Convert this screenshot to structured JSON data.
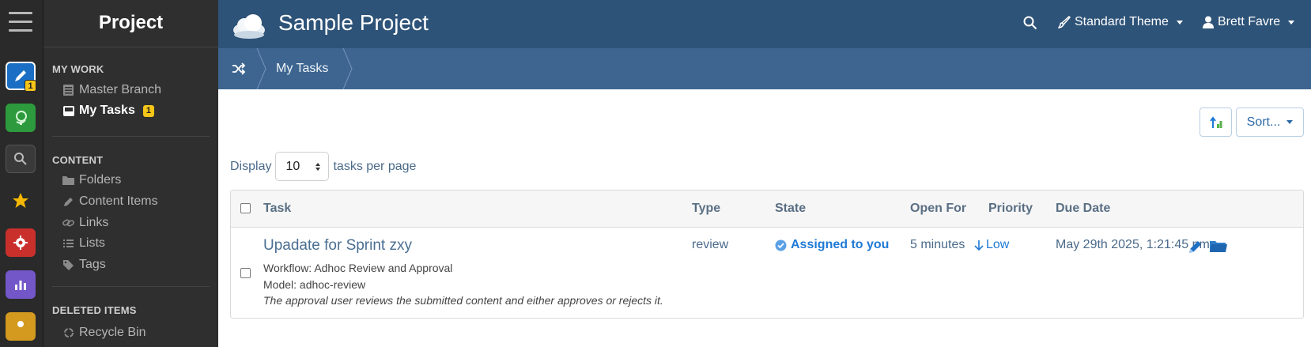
{
  "nav": {
    "title": "Project",
    "sections": {
      "my_work": "MY WORK",
      "content": "CONTENT",
      "deleted": "DELETED ITEMS"
    },
    "items": {
      "master_branch": "Master Branch",
      "my_tasks": "My Tasks",
      "my_tasks_badge": "1",
      "folders": "Folders",
      "content_items": "Content Items",
      "links": "Links",
      "lists": "Lists",
      "tags": "Tags",
      "recycle_bin": "Recycle Bin"
    }
  },
  "rail": {
    "edit_badge": "1",
    "icons": [
      "hamburger-icon",
      "pencil-icon",
      "globe-icon",
      "search-icon",
      "star-icon",
      "gear-icon",
      "chart-icon",
      "users-icon"
    ]
  },
  "header": {
    "app_title": "Sample Project",
    "theme_label": "Standard Theme",
    "user_label": "Brett Favre"
  },
  "breadcrumb": {
    "current": "My Tasks"
  },
  "toolbar": {
    "sort_label": "Sort..."
  },
  "pagination": {
    "display_label": "Display",
    "per_page_value": "10",
    "per_page_suffix": "tasks per page"
  },
  "table": {
    "columns": {
      "task": "Task",
      "type": "Type",
      "state": "State",
      "open_for": "Open For",
      "priority": "Priority",
      "due_date": "Due Date"
    },
    "rows": [
      {
        "title": "Upadate for Sprint zxy",
        "workflow": "Workflow: Adhoc Review and Approval",
        "model": "Model: adhoc-review",
        "description": "The approval user reviews the submitted content and either approves or rejects it.",
        "type": "review",
        "state": "Assigned to you",
        "open_for": "5 minutes",
        "priority": "Low",
        "due_date": "May 29th 2025, 1:21:45 pm"
      }
    ]
  },
  "colors": {
    "header_bg": "#2e5378",
    "breadcrumb_bg": "#3d6590",
    "link": "#1f7ad6",
    "badge": "#f5c518"
  }
}
